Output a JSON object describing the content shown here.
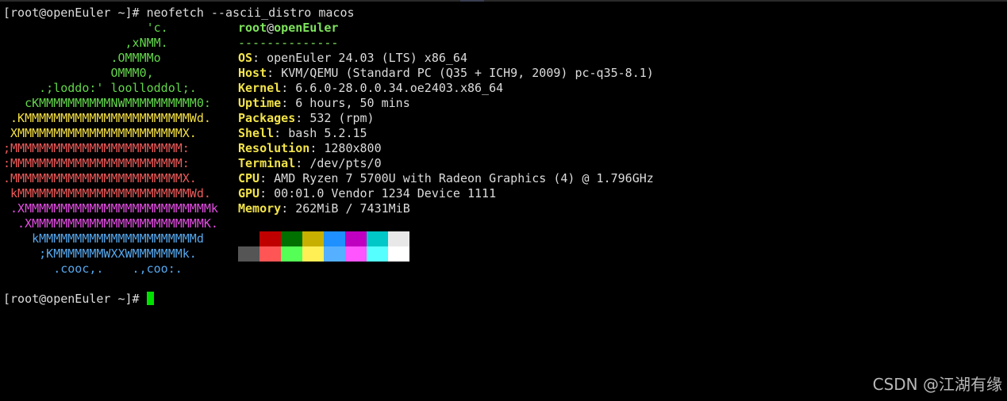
{
  "terminal": {
    "command_line": "[root@openEuler ~]# neofetch --ascii_distro macos",
    "prompt": "[root@openEuler ~]# "
  },
  "logo": [
    {
      "text": "                    'c.",
      "color": "#62d64a"
    },
    {
      "text": "                 ,xNMM.",
      "color": "#62d64a"
    },
    {
      "text": "               .OMMMMo",
      "color": "#62d64a"
    },
    {
      "text": "               OMMM0,",
      "color": "#62d64a"
    },
    {
      "text": "     .;loddo:' loolloddol;.",
      "color": "#62d64a"
    },
    {
      "text": "   cKMMMMMMMMMMNWMMMMMMMMMM0:",
      "color": "#62d64a"
    },
    {
      "text": " .KMMMMMMMMMMMMMMMMMMMMMMMWd.",
      "color": "#f5e043"
    },
    {
      "text": " XMMMMMMMMMMMMMMMMMMMMMMMX.",
      "color": "#f5e043"
    },
    {
      "text": ";MMMMMMMMMMMMMMMMMMMMMMMM:",
      "color": "#ef5a5a"
    },
    {
      "text": ":MMMMMMMMMMMMMMMMMMMMMMMM:",
      "color": "#ef5a5a"
    },
    {
      "text": ".MMMMMMMMMMMMMMMMMMMMMMMMX.",
      "color": "#ef5a5a"
    },
    {
      "text": " kMMMMMMMMMMMMMMMMMMMMMMMMWd.",
      "color": "#ef5a5a"
    },
    {
      "text": " .XMMMMMMMMMMMMMMMMMMMMMMMMMMk",
      "color": "#e64ee6"
    },
    {
      "text": "  .XMMMMMMMMMMMMMMMMMMMMMMMMK.",
      "color": "#e64ee6"
    },
    {
      "text": "    kMMMMMMMMMMMMMMMMMMMMMMd",
      "color": "#56a8ee"
    },
    {
      "text": "     ;KMMMMMMMWXXWMMMMMMMk.",
      "color": "#56a8ee"
    },
    {
      "text": "       .cooc,.    .,coo:.",
      "color": "#56a8ee"
    }
  ],
  "info": {
    "user": "root",
    "at": "@",
    "host": "openEuler",
    "separator": "--------------",
    "sep": ": ",
    "fields": [
      {
        "key": "OS",
        "value": "openEuler 24.03 (LTS) x86_64"
      },
      {
        "key": "Host",
        "value": "KVM/QEMU (Standard PC (Q35 + ICH9, 2009) pc-q35-8.1)"
      },
      {
        "key": "Kernel",
        "value": "6.6.0-28.0.0.34.oe2403.x86_64"
      },
      {
        "key": "Uptime",
        "value": "6 hours, 50 mins"
      },
      {
        "key": "Packages",
        "value": "532 (rpm)"
      },
      {
        "key": "Shell",
        "value": "bash 5.2.15"
      },
      {
        "key": "Resolution",
        "value": "1280x800"
      },
      {
        "key": "Terminal",
        "value": "/dev/pts/0"
      },
      {
        "key": "CPU",
        "value": "AMD Ryzen 7 5700U with Radeon Graphics (4) @ 1.796GHz"
      },
      {
        "key": "GPU",
        "value": "00:01.0 Vendor 1234 Device 1111"
      },
      {
        "key": "Memory",
        "value": "262MiB / 7431MiB"
      }
    ]
  },
  "palette": {
    "row1": [
      "#000000",
      "#c00000",
      "#007000",
      "#c8b000",
      "#1e90ff",
      "#c000c0",
      "#00c8c8",
      "#e8e8e8"
    ],
    "row2": [
      "#555555",
      "#ff5555",
      "#55ff55",
      "#ffef55",
      "#55b0ff",
      "#ff55ff",
      "#55ffff",
      "#ffffff"
    ]
  },
  "watermark": "CSDN @江湖有缘"
}
